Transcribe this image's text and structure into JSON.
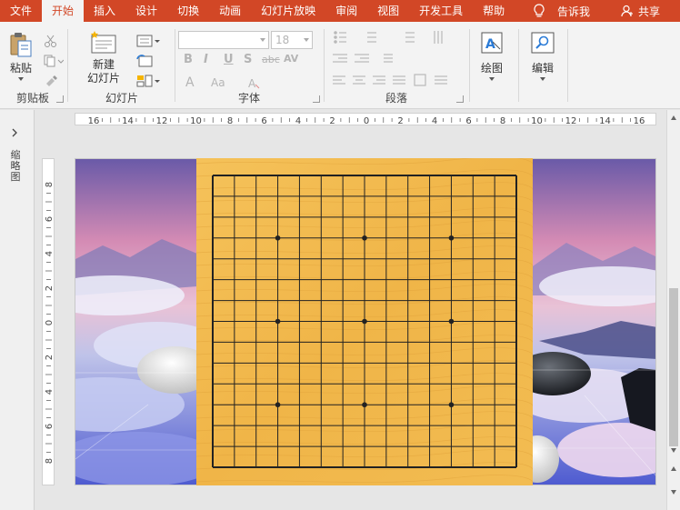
{
  "ribbon_tabs": [
    "文件",
    "开始",
    "插入",
    "设计",
    "切换",
    "动画",
    "幻灯片放映",
    "审阅",
    "视图",
    "开发工具",
    "帮助"
  ],
  "active_tab": "开始",
  "tell_me": "告诉我",
  "share": "共享",
  "groups": {
    "clipboard": {
      "label": "剪贴板",
      "paste": "粘贴"
    },
    "slides": {
      "label": "幻灯片",
      "new_slide_line1": "新建",
      "new_slide_line2": "幻灯片"
    },
    "font": {
      "label": "字体",
      "font_name": "",
      "font_size": "18",
      "bold": "B",
      "italic": "I",
      "underline": "U",
      "shadow": "S",
      "strike": "abc",
      "spacing": "AV",
      "font_color": "A",
      "change_case": "Aa"
    },
    "paragraph": {
      "label": "段落"
    },
    "drawing": {
      "label": "绘图"
    },
    "editing": {
      "label": "编辑"
    }
  },
  "thumbnail_pane_label": "缩略图",
  "ruler_h_labels": [
    "16",
    "14",
    "12",
    "10",
    "8",
    "6",
    "4",
    "2",
    "0",
    "2",
    "4",
    "6",
    "8",
    "10",
    "12",
    "14",
    "16"
  ],
  "ruler_v_labels": [
    "8",
    "6",
    "4",
    "2",
    "0",
    "2",
    "4",
    "6",
    "8"
  ],
  "board": {
    "lines": 15,
    "star_points": [
      [
        3,
        3
      ],
      [
        3,
        7
      ],
      [
        3,
        11
      ],
      [
        7,
        3
      ],
      [
        7,
        7
      ],
      [
        7,
        11
      ],
      [
        11,
        3
      ],
      [
        11,
        7
      ],
      [
        11,
        11
      ]
    ]
  },
  "colors": {
    "accent": "#d24726",
    "board_wood": "#f2b84c",
    "grid_line": "#222222"
  }
}
